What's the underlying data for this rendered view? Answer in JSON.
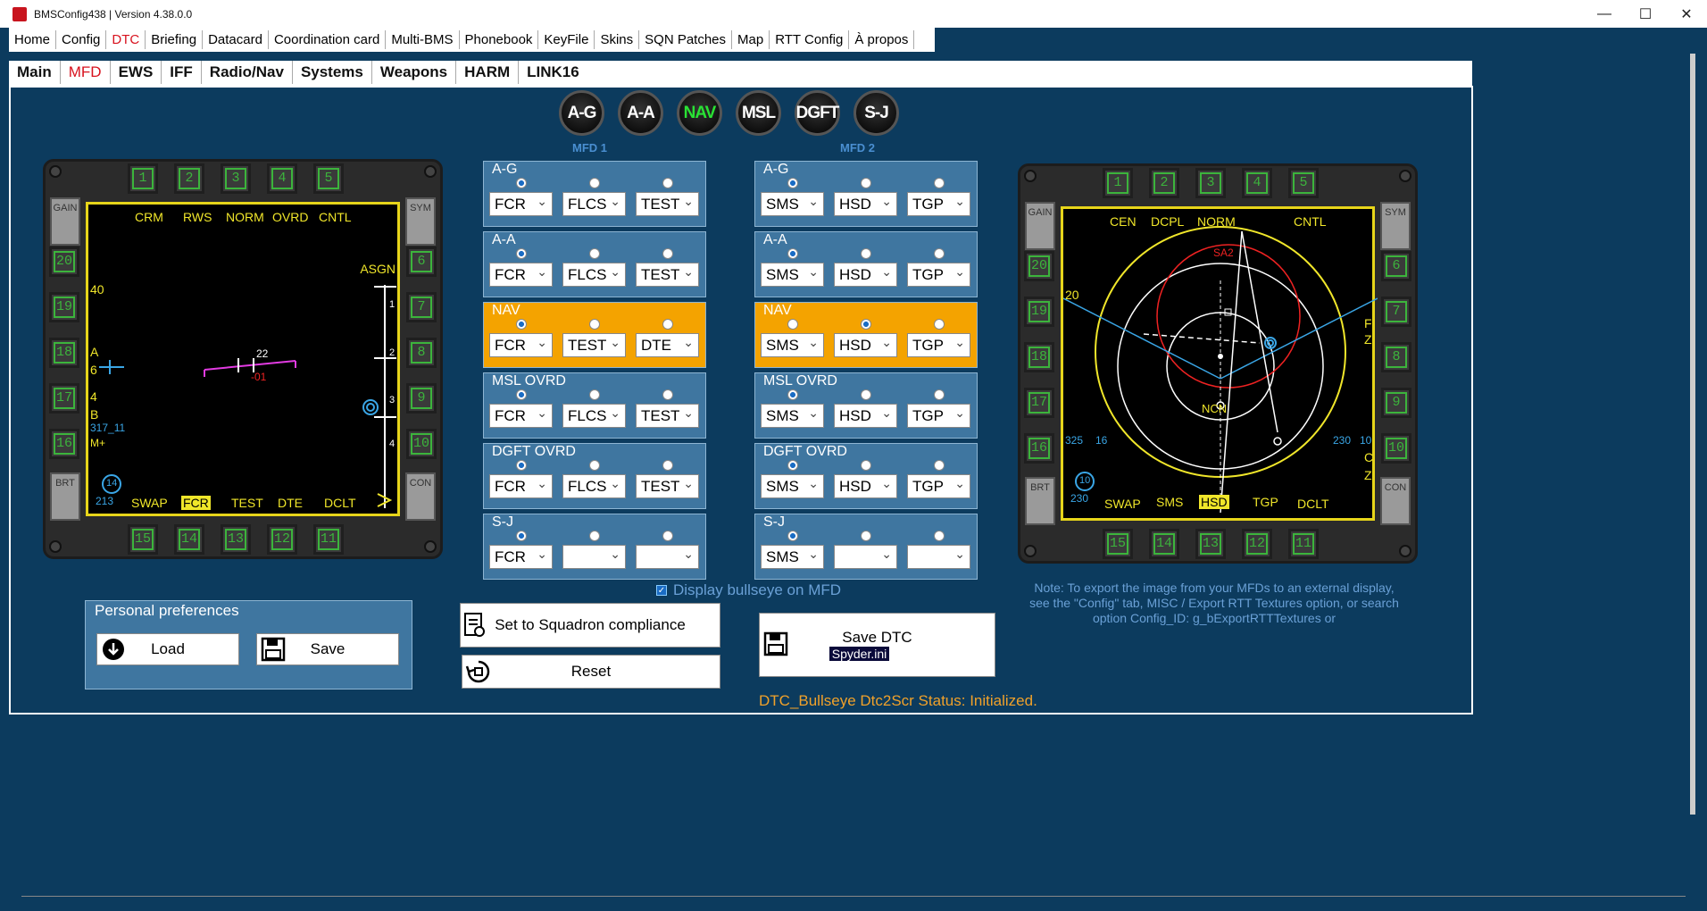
{
  "window": {
    "title": "BMSConfig438 | Version 4.38.0.0",
    "min": "—",
    "max": "☐",
    "close": "✕"
  },
  "menu": [
    "Home",
    "Config",
    "DTC",
    "Briefing",
    "Datacard",
    "Coordination card",
    "Multi-BMS",
    "Phonebook",
    "KeyFile",
    "Skins",
    "SQN Patches",
    "Map",
    "RTT Config",
    "À propos"
  ],
  "subtabs": [
    "Main",
    "MFD",
    "EWS",
    "IFF",
    "Radio/Nav",
    "Systems",
    "Weapons",
    "HARM",
    "LINK16"
  ],
  "modes": [
    "A-G",
    "A-A",
    "NAV",
    "MSL",
    "DGFT",
    "S-J"
  ],
  "mfd1": {
    "label": "MFD 1",
    "top_osb": [
      "1",
      "2",
      "3",
      "4",
      "5"
    ],
    "right_osb": [
      "6",
      "7",
      "8",
      "9",
      "10"
    ],
    "bottom_osb": [
      "15",
      "14",
      "13",
      "12",
      "11"
    ],
    "left_osb": [
      "20",
      "19",
      "18",
      "17",
      "16"
    ],
    "rockers": {
      "gain": "GAIN",
      "sym": "SYM",
      "brt": "BRT",
      "con": "CON"
    },
    "top_labels": [
      "CRM",
      "RWS",
      "NORM",
      "OVRD",
      "CNTL"
    ],
    "bottom_labels": [
      "SWAP",
      "FCR",
      "TEST",
      "DTE",
      "DCLT"
    ],
    "asgn": "ASGN",
    "alt": "40",
    "a_label": "A",
    "six": "6",
    "four": "4",
    "b_label": "B",
    "bearing": "317_11",
    "mplus": "M+",
    "heading": "213",
    "range_num": "14",
    "alt2": "22",
    "err": "-01",
    "tick1": "1",
    "tick2": "2",
    "tick3": "3",
    "tick4": "4"
  },
  "mfd2": {
    "label": "MFD 2",
    "top_osb": [
      "1",
      "2",
      "3",
      "4",
      "5"
    ],
    "right_osb": [
      "6",
      "7",
      "8",
      "9",
      "10"
    ],
    "bottom_osb": [
      "15",
      "14",
      "13",
      "12",
      "11"
    ],
    "left_osb": [
      "20",
      "19",
      "18",
      "17",
      "16"
    ],
    "top_labels": [
      "CEN",
      "DCPL",
      "NORM",
      "CNTL"
    ],
    "bottom_labels": [
      "SWAP",
      "SMS",
      "HSD",
      "TGP",
      "DCLT"
    ],
    "sa": "SA2",
    "ncn": "NCN",
    "num20": "20",
    "l325": "325",
    "l16": "16",
    "r230": "230",
    "r10": "10",
    "bl230": "230",
    "bl10": "10",
    "f": "F",
    "z": "Z",
    "c": "C",
    "z2": "Z"
  },
  "mfd1_config": [
    {
      "name": "A-G",
      "sel": 0,
      "vals": [
        "FCR",
        "FLCS",
        "TEST"
      ],
      "hl": false
    },
    {
      "name": "A-A",
      "sel": 0,
      "vals": [
        "FCR",
        "FLCS",
        "TEST"
      ],
      "hl": false
    },
    {
      "name": "NAV",
      "sel": 0,
      "vals": [
        "FCR",
        "TEST",
        "DTE"
      ],
      "hl": true
    },
    {
      "name": "MSL OVRD",
      "sel": 0,
      "vals": [
        "FCR",
        "FLCS",
        "TEST"
      ],
      "hl": false
    },
    {
      "name": "DGFT OVRD",
      "sel": 0,
      "vals": [
        "FCR",
        "FLCS",
        "TEST"
      ],
      "hl": false
    },
    {
      "name": "S-J",
      "sel": 0,
      "vals": [
        "FCR",
        "",
        ""
      ],
      "hl": false
    }
  ],
  "mfd2_config": [
    {
      "name": "A-G",
      "sel": 0,
      "vals": [
        "SMS",
        "HSD",
        "TGP"
      ],
      "hl": false
    },
    {
      "name": "A-A",
      "sel": 0,
      "vals": [
        "SMS",
        "HSD",
        "TGP"
      ],
      "hl": false
    },
    {
      "name": "NAV",
      "sel": 1,
      "vals": [
        "SMS",
        "HSD",
        "TGP"
      ],
      "hl": true
    },
    {
      "name": "MSL OVRD",
      "sel": 0,
      "vals": [
        "SMS",
        "HSD",
        "TGP"
      ],
      "hl": false
    },
    {
      "name": "DGFT OVRD",
      "sel": 0,
      "vals": [
        "SMS",
        "HSD",
        "TGP"
      ],
      "hl": false
    },
    {
      "name": "S-J",
      "sel": 0,
      "vals": [
        "SMS",
        "",
        ""
      ],
      "hl": false
    }
  ],
  "bullseye_label": "Display bullseye on MFD",
  "prefs": {
    "title": "Personal preferences",
    "load": "Load",
    "save": "Save"
  },
  "squadron": "Set to Squadron compliance",
  "reset": "Reset",
  "save_dtc": "Save DTC",
  "dtc_file": "Spyder.ini",
  "note": "Note: To export the image from your MFDs to an external display, see the \"Config\" tab, MISC / Export RTT Textures option, or search option Config_ID: g_bExportRTTTextures or",
  "status": "DTC_Bullseye Dtc2Scr Status: Initialized."
}
